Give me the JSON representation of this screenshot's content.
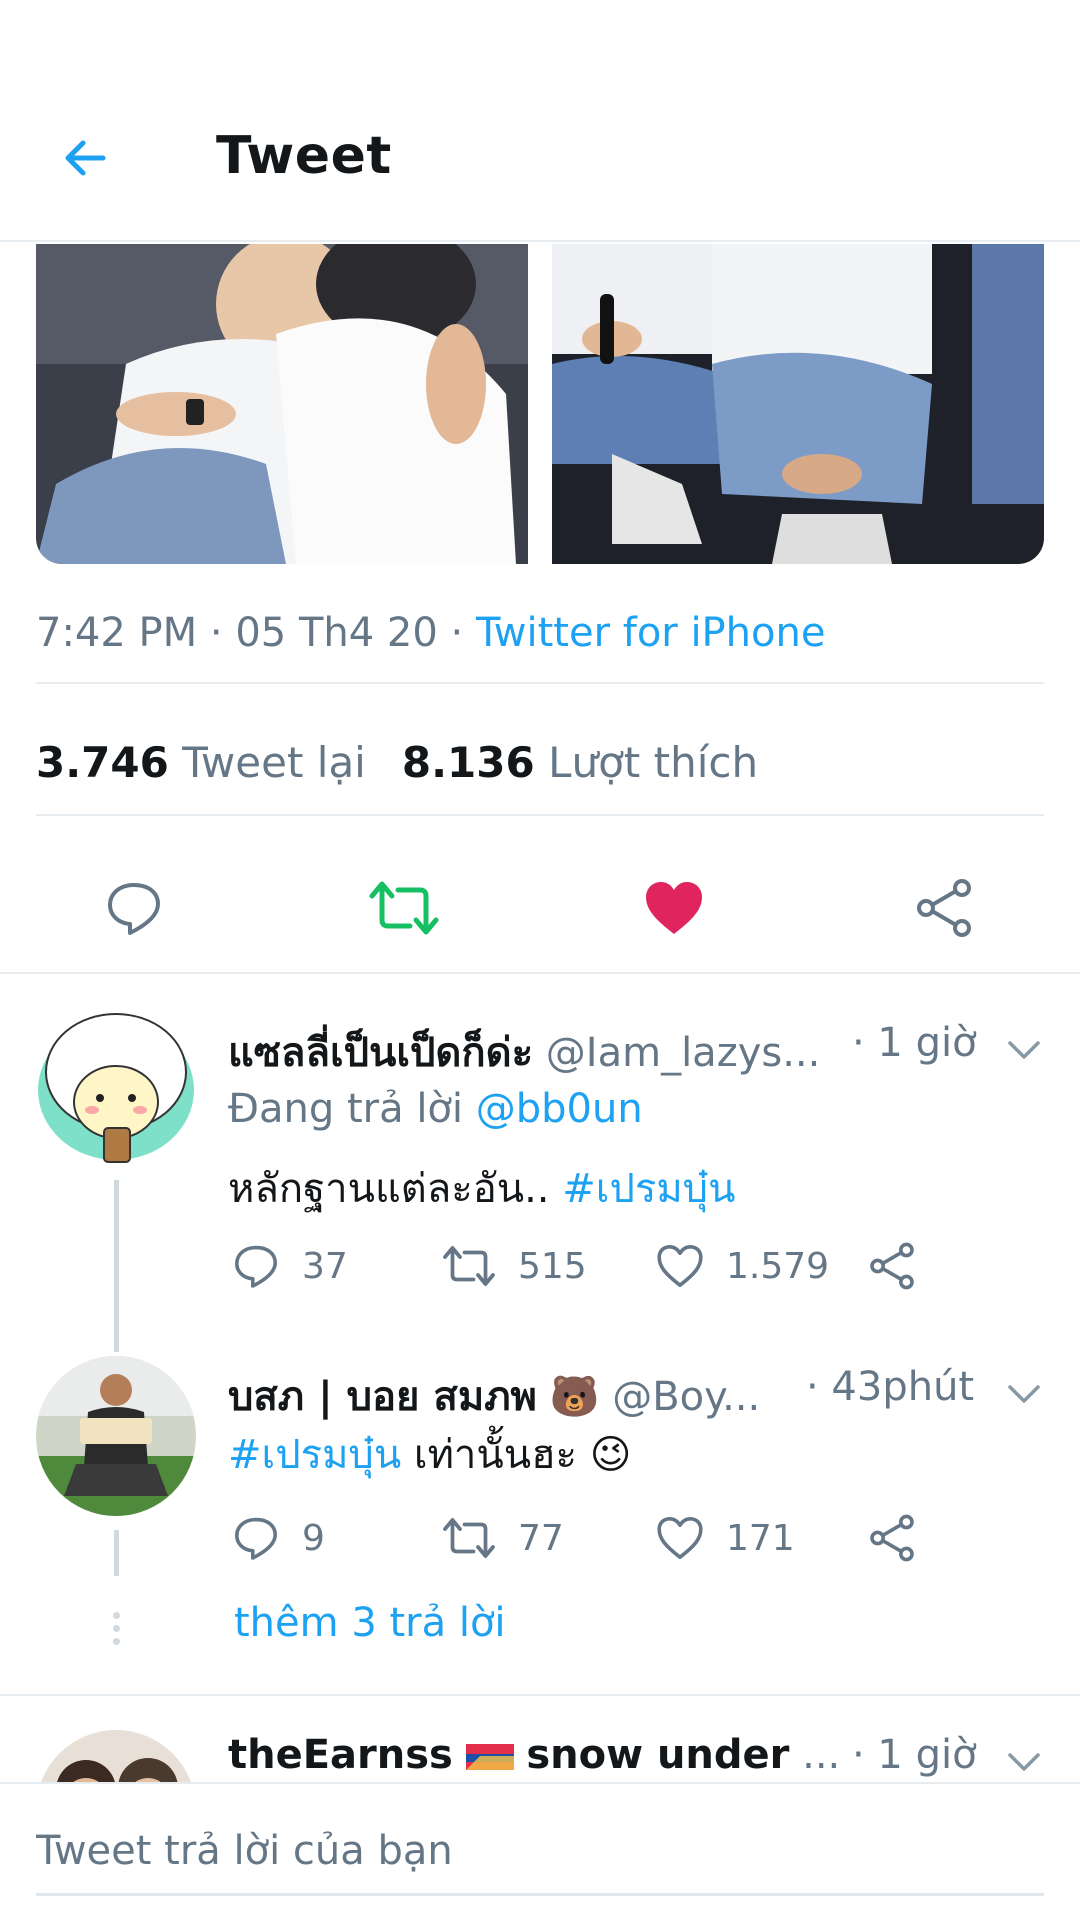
{
  "header": {
    "title": "Tweet"
  },
  "tweet": {
    "time": "7:42 PM",
    "date": "05 Th4 20",
    "source": "Twitter for iPhone",
    "retweets_count": "3.746",
    "retweets_label": "Tweet lại",
    "likes_count": "8.136",
    "likes_label": "Lượt thích",
    "colors": {
      "retweet": "#17bf63",
      "like": "#e0245e",
      "link": "#1da1f2"
    }
  },
  "replies": [
    {
      "name": "แซลลี่เป็นเป็ดก็ด่ะ",
      "handle": "@Iam_lazys...",
      "time": "· 1 giờ",
      "replying_label": "Đang trả lời",
      "replying_to": "@bb0un",
      "text": "หลักฐานแต่ละอัน..",
      "hashtag": "#เปรมบุ๋น",
      "reply_count": "37",
      "retweet_count": "515",
      "like_count": "1.579"
    },
    {
      "name": "บสภ | บอย สมภพ",
      "name_emoji": "🐻",
      "handle": "@Boy...",
      "time": "· 43phút",
      "hashtag": "#เปรมบุ๋น",
      "text": "เท่านั้นฮะ",
      "text_emoji": "😉",
      "reply_count": "9",
      "retweet_count": "77",
      "like_count": "171"
    },
    {
      "name": "theEarnss",
      "name_suffix": "snow under",
      "handle": "...",
      "time": "· 1 giờ"
    }
  ],
  "more_replies": "thêm 3 trả lời",
  "composer": {
    "placeholder": "Tweet trả lời của bạn"
  }
}
